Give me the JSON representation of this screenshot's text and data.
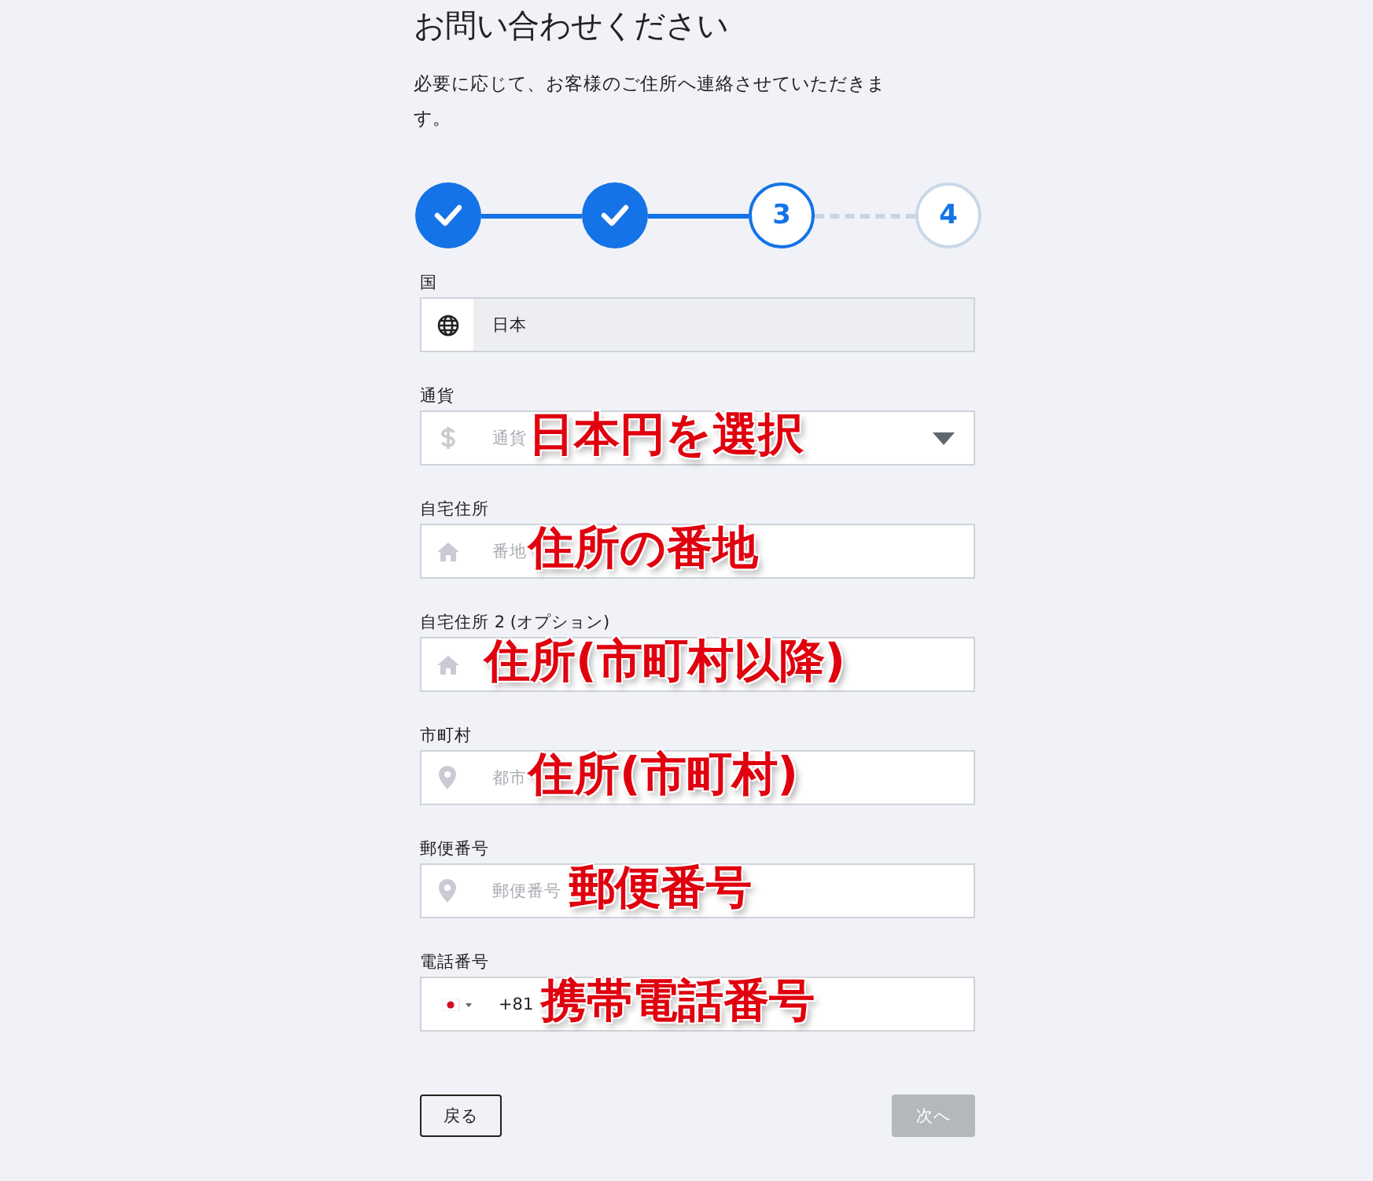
{
  "title": "お問い合わせください",
  "intro": "必要に応じて、お客様のご住所へ連絡させていただきます。",
  "steps": [
    {
      "done": true
    },
    {
      "done": true
    },
    {
      "label": "3",
      "done": false
    },
    {
      "label": "4",
      "done": false
    }
  ],
  "fields": [
    {
      "label": "国",
      "kind": "readonly",
      "value": "日本"
    },
    {
      "label": "通貨",
      "kind": "select",
      "placeholder": "通貨",
      "annotation": "日本円を選択"
    },
    {
      "label": "自宅住所",
      "kind": "text",
      "placeholder": "番地",
      "annotation": "住所の番地"
    },
    {
      "label": "自宅住所 2 (オプション)",
      "kind": "text",
      "annotation": "住所(市町村以降)"
    },
    {
      "label": "市町村",
      "kind": "text",
      "placeholder": "都市",
      "annotation": "住所(市町村)"
    },
    {
      "label": "郵便番号",
      "kind": "text",
      "placeholder": "郵便番号",
      "annotation": "郵便番号"
    },
    {
      "label": "電話番号",
      "kind": "phone",
      "value": "+81",
      "annotation": "携帯電話番号"
    }
  ],
  "buttons": {
    "back": {
      "label": "戻る",
      "disabled": false
    },
    "next": {
      "label": "次へ",
      "disabled": true
    }
  }
}
